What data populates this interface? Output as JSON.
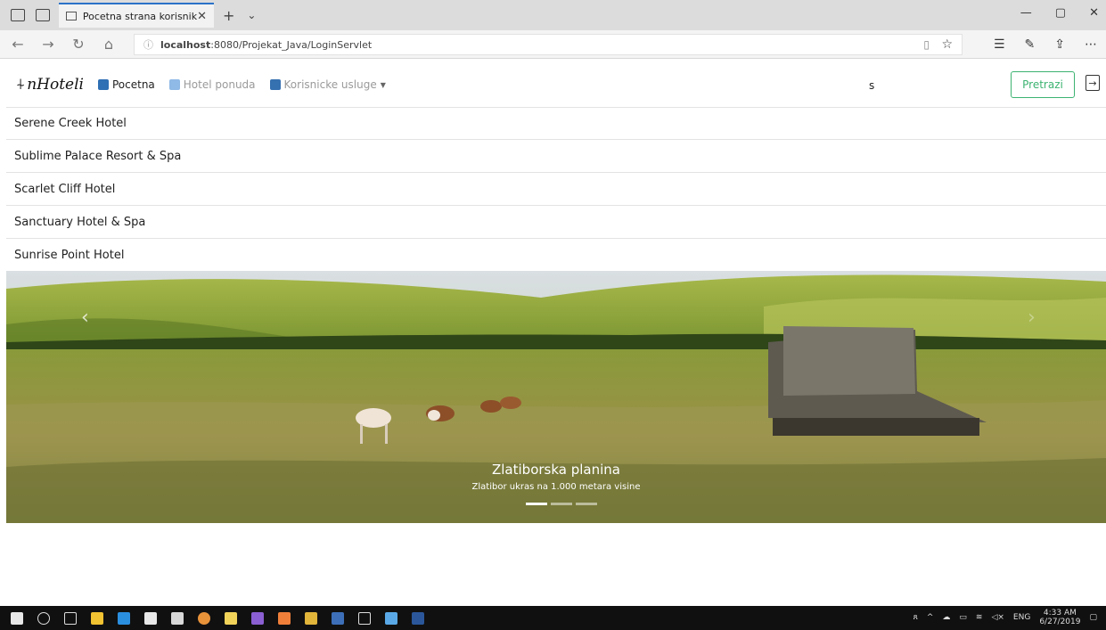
{
  "browser": {
    "tab_title": "Pocetna strana korisnik",
    "url_host": "localhost",
    "url_rest": ":8080/Projekat_Java/LoginServlet"
  },
  "navbar": {
    "brand": "nHoteli",
    "items": [
      {
        "label": "Pocetna",
        "icon": "home-icon"
      },
      {
        "label": "Hotel ponuda",
        "icon": "hotel-icon"
      },
      {
        "label": "Korisnicke usluge",
        "icon": "user-icon"
      }
    ],
    "search_value": "s",
    "search_button": "Pretrazi"
  },
  "suggestions": [
    "Serene Creek Hotel",
    "Sublime Palace Resort & Spa",
    "Scarlet Cliff Hotel",
    "Sanctuary Hotel & Spa",
    "Sunrise Point Hotel"
  ],
  "carousel": {
    "title": "Zlatiborska planina",
    "subtitle": "Zlatibor ukras na 1.000 metara visine",
    "slides": 3,
    "active_index": 0
  },
  "taskbar": {
    "language": "ENG",
    "time": "4:33 AM",
    "date": "6/27/2019"
  },
  "colors": {
    "accent": "#3cb371",
    "tab_accent": "#2b72c8"
  }
}
